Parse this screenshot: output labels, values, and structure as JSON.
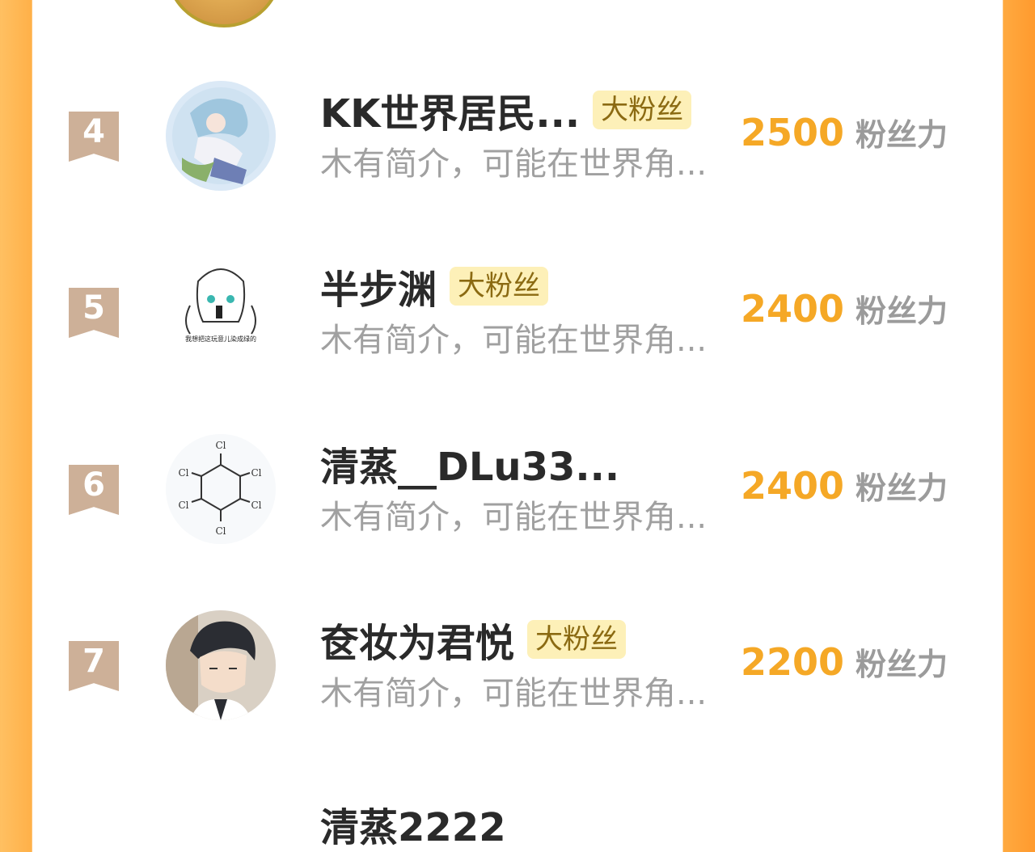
{
  "leaderboard": {
    "unit_label": "粉丝力",
    "rows": [
      {
        "rank": "4",
        "name": "KK世界居民...",
        "badge": "大粉丝",
        "desc": "木有简介，可能在世界角...",
        "score": "2500"
      },
      {
        "rank": "5",
        "name": "半步渊",
        "badge": "大粉丝",
        "desc": "木有简介，可能在世界角...",
        "score": "2400"
      },
      {
        "rank": "6",
        "name": "清蒸__DLu33...",
        "badge": "",
        "desc": "木有简介，可能在世界角...",
        "score": "2400"
      },
      {
        "rank": "7",
        "name": "奁妆为君悦",
        "badge": "大粉丝",
        "desc": "木有简介，可能在世界角...",
        "score": "2200"
      }
    ],
    "avatar5_caption": "我想把这玩意儿染成绿的",
    "avatar6_labels": [
      "Cl",
      "Cl",
      "Cl",
      "Cl",
      "Cl",
      "Cl"
    ],
    "next_row_name_partial": "清蒸2222"
  },
  "colors": {
    "score": "#f5a826",
    "badge_bg": "#fdf0b8",
    "rank_bg": "#cdb098",
    "side_orange": "#ffb048"
  }
}
